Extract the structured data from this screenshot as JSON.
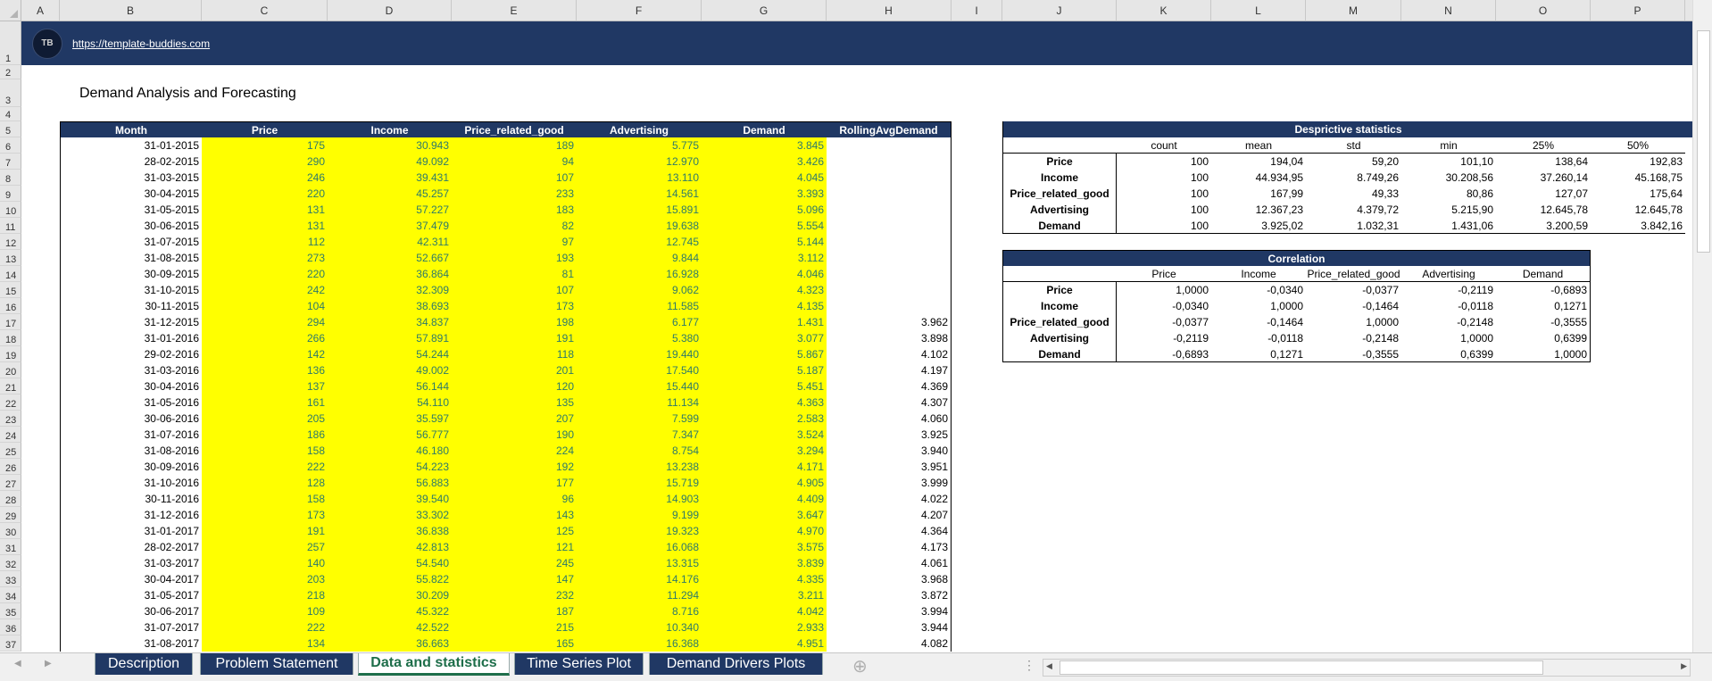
{
  "columns": [
    "A",
    "B",
    "C",
    "D",
    "E",
    "F",
    "G",
    "H",
    "I",
    "J",
    "K",
    "L",
    "M",
    "N",
    "O",
    "P"
  ],
  "banner": {
    "logo_text": "TB",
    "link": "https://template-buddies.com"
  },
  "title": "Demand Analysis and Forecasting",
  "data_table": {
    "headers": [
      "Month",
      "Price",
      "Income",
      "Price_related_good",
      "Advertising",
      "Demand",
      "RollingAvgDemand"
    ],
    "rows": [
      [
        "31-01-2015",
        "175",
        "30.943",
        "189",
        "5.775",
        "3.845",
        ""
      ],
      [
        "28-02-2015",
        "290",
        "49.092",
        "94",
        "12.970",
        "3.426",
        ""
      ],
      [
        "31-03-2015",
        "246",
        "39.431",
        "107",
        "13.110",
        "4.045",
        ""
      ],
      [
        "30-04-2015",
        "220",
        "45.257",
        "233",
        "14.561",
        "3.393",
        ""
      ],
      [
        "31-05-2015",
        "131",
        "57.227",
        "183",
        "15.891",
        "5.096",
        ""
      ],
      [
        "30-06-2015",
        "131",
        "37.479",
        "82",
        "19.638",
        "5.554",
        ""
      ],
      [
        "31-07-2015",
        "112",
        "42.311",
        "97",
        "12.745",
        "5.144",
        ""
      ],
      [
        "31-08-2015",
        "273",
        "52.667",
        "193",
        "9.844",
        "3.112",
        ""
      ],
      [
        "30-09-2015",
        "220",
        "36.864",
        "81",
        "16.928",
        "4.046",
        ""
      ],
      [
        "31-10-2015",
        "242",
        "32.309",
        "107",
        "9.062",
        "4.323",
        ""
      ],
      [
        "30-11-2015",
        "104",
        "38.693",
        "173",
        "11.585",
        "4.135",
        ""
      ],
      [
        "31-12-2015",
        "294",
        "34.837",
        "198",
        "6.177",
        "1.431",
        "3.962"
      ],
      [
        "31-01-2016",
        "266",
        "57.891",
        "191",
        "5.380",
        "3.077",
        "3.898"
      ],
      [
        "29-02-2016",
        "142",
        "54.244",
        "118",
        "19.440",
        "5.867",
        "4.102"
      ],
      [
        "31-03-2016",
        "136",
        "49.002",
        "201",
        "17.540",
        "5.187",
        "4.197"
      ],
      [
        "30-04-2016",
        "137",
        "56.144",
        "120",
        "15.440",
        "5.451",
        "4.369"
      ],
      [
        "31-05-2016",
        "161",
        "54.110",
        "135",
        "11.134",
        "4.363",
        "4.307"
      ],
      [
        "30-06-2016",
        "205",
        "35.597",
        "207",
        "7.599",
        "2.583",
        "4.060"
      ],
      [
        "31-07-2016",
        "186",
        "56.777",
        "190",
        "7.347",
        "3.524",
        "3.925"
      ],
      [
        "31-08-2016",
        "158",
        "46.180",
        "224",
        "8.754",
        "3.294",
        "3.940"
      ],
      [
        "30-09-2016",
        "222",
        "54.223",
        "192",
        "13.238",
        "4.171",
        "3.951"
      ],
      [
        "31-10-2016",
        "128",
        "56.883",
        "177",
        "15.719",
        "4.905",
        "3.999"
      ],
      [
        "30-11-2016",
        "158",
        "39.540",
        "96",
        "14.903",
        "4.409",
        "4.022"
      ],
      [
        "31-12-2016",
        "173",
        "33.302",
        "143",
        "9.199",
        "3.647",
        "4.207"
      ],
      [
        "31-01-2017",
        "191",
        "36.838",
        "125",
        "19.323",
        "4.970",
        "4.364"
      ],
      [
        "28-02-2017",
        "257",
        "42.813",
        "121",
        "16.068",
        "3.575",
        "4.173"
      ],
      [
        "31-03-2017",
        "140",
        "54.540",
        "245",
        "13.315",
        "3.839",
        "4.061"
      ],
      [
        "30-04-2017",
        "203",
        "55.822",
        "147",
        "14.176",
        "4.335",
        "3.968"
      ],
      [
        "31-05-2017",
        "218",
        "30.209",
        "232",
        "11.294",
        "3.211",
        "3.872"
      ],
      [
        "30-06-2017",
        "109",
        "45.322",
        "187",
        "8.716",
        "4.042",
        "3.994"
      ],
      [
        "31-07-2017",
        "222",
        "42.522",
        "215",
        "10.340",
        "2.933",
        "3.944"
      ],
      [
        "31-08-2017",
        "134",
        "36.663",
        "165",
        "16.368",
        "4.951",
        "4.082"
      ]
    ]
  },
  "stats": {
    "title": "Desprictive statistics",
    "columns": [
      "count",
      "mean",
      "std",
      "min",
      "25%",
      "50%"
    ],
    "rows": [
      {
        "label": "Price",
        "values": [
          "100",
          "194,04",
          "59,20",
          "101,10",
          "138,64",
          "192,83"
        ]
      },
      {
        "label": "Income",
        "values": [
          "100",
          "44.934,95",
          "8.749,26",
          "30.208,56",
          "37.260,14",
          "45.168,75"
        ]
      },
      {
        "label": "Price_related_good",
        "values": [
          "100",
          "167,99",
          "49,33",
          "80,86",
          "127,07",
          "175,64"
        ]
      },
      {
        "label": "Advertising",
        "values": [
          "100",
          "12.367,23",
          "4.379,72",
          "5.215,90",
          "12.645,78",
          "12.645,78"
        ]
      },
      {
        "label": "Demand",
        "values": [
          "100",
          "3.925,02",
          "1.032,31",
          "1.431,06",
          "3.200,59",
          "3.842,16"
        ]
      }
    ]
  },
  "correlation": {
    "title": "Correlation",
    "columns": [
      "Price",
      "Income",
      "Price_related_good",
      "Advertising",
      "Demand"
    ],
    "rows": [
      {
        "label": "Price",
        "values": [
          "1,0000",
          "-0,0340",
          "-0,0377",
          "-0,2119",
          "-0,6893"
        ]
      },
      {
        "label": "Income",
        "values": [
          "-0,0340",
          "1,0000",
          "-0,1464",
          "-0,0118",
          "0,1271"
        ]
      },
      {
        "label": "Price_related_good",
        "values": [
          "-0,0377",
          "-0,1464",
          "1,0000",
          "-0,2148",
          "-0,3555"
        ]
      },
      {
        "label": "Advertising",
        "values": [
          "-0,2119",
          "-0,0118",
          "-0,2148",
          "1,0000",
          "0,6399"
        ]
      },
      {
        "label": "Demand",
        "values": [
          "-0,6893",
          "0,1271",
          "-0,3555",
          "0,6399",
          "1,0000"
        ]
      }
    ]
  },
  "tabs": [
    {
      "label": "Description",
      "active": false
    },
    {
      "label": "Problem Statement",
      "active": false
    },
    {
      "label": "Data and statistics",
      "active": true
    },
    {
      "label": "Time Series Plot",
      "active": false
    },
    {
      "label": "Demand Drivers Plots",
      "active": false
    }
  ],
  "tabbar": {
    "prev": "◀",
    "next": "▶",
    "add": "⊕",
    "more": "⋮",
    "scroll_left": "◀",
    "scroll_right": "▶"
  },
  "colors": {
    "navy": "#203864",
    "yellow": "#ffff00",
    "value_text": "#2e7a6a",
    "active_tab": "#1e6e4a"
  }
}
